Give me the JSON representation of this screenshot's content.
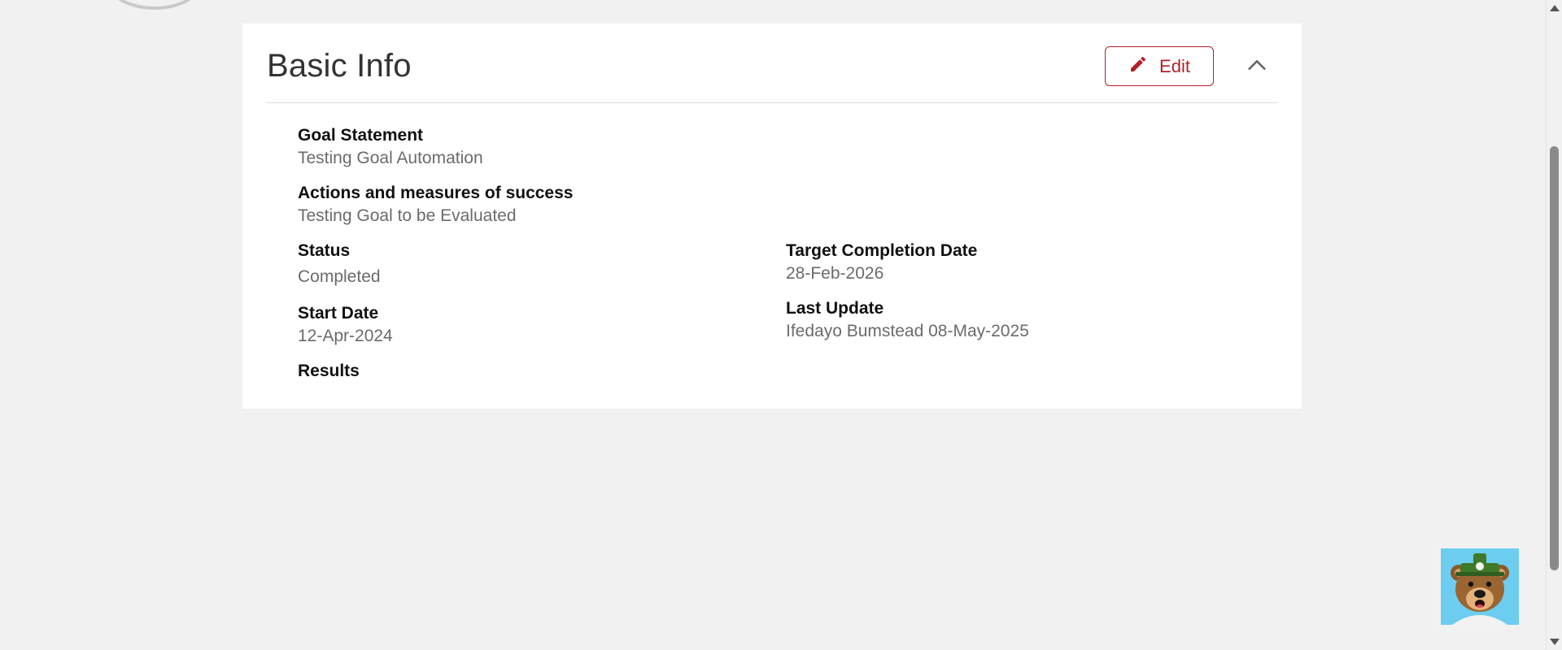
{
  "card": {
    "title": "Basic Info",
    "edit_label": "Edit"
  },
  "fields": {
    "goal_statement": {
      "label": "Goal Statement",
      "value": "Testing Goal Automation"
    },
    "actions": {
      "label": "Actions and measures of success",
      "value": "Testing Goal to be Evaluated"
    },
    "status": {
      "label": "Status",
      "value": "Completed"
    },
    "start_date": {
      "label": "Start Date",
      "value": "12-Apr-2024"
    },
    "results": {
      "label": "Results"
    },
    "target_completion": {
      "label": "Target Completion Date",
      "value": "28-Feb-2026"
    },
    "last_update": {
      "label": "Last Update",
      "value": "Ifedayo Bumstead 08-May-2025"
    }
  },
  "icons": {
    "edit": "pencil-icon",
    "collapse": "chevron-up-icon",
    "chatbot": "bear-mascot-icon"
  },
  "colors": {
    "accent": "#b2202a",
    "background": "#f1f1f1",
    "card": "#ffffff",
    "value_text": "#6b6b6b",
    "chatbot_bg": "#6ccdf0"
  }
}
